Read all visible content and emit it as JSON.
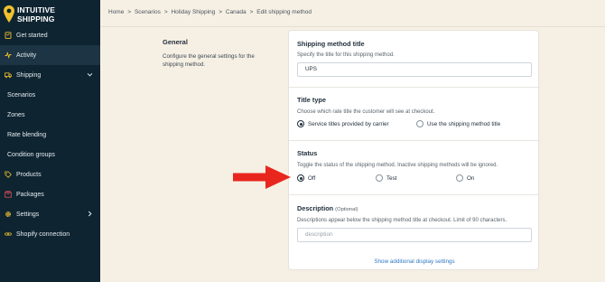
{
  "sidebar": {
    "logo_line1": "INTUITIVE",
    "logo_line2": "SHIPPING",
    "items": [
      {
        "label": "Get started",
        "icon": "checklist-icon"
      },
      {
        "label": "Activity",
        "icon": "activity-icon"
      },
      {
        "label": "Shipping",
        "icon": "truck-icon",
        "expanded": true
      },
      {
        "label": "Scenarios"
      },
      {
        "label": "Zones"
      },
      {
        "label": "Rate blending"
      },
      {
        "label": "Condition groups"
      },
      {
        "label": "Products",
        "icon": "tag-icon"
      },
      {
        "label": "Packages",
        "icon": "box-icon"
      },
      {
        "label": "Settings",
        "icon": "gear-icon"
      },
      {
        "label": "Shopify connection",
        "icon": "link-icon"
      }
    ]
  },
  "breadcrumb": [
    "Home",
    "Scenarios",
    "Holiday Shipping",
    "Canada",
    "Edit shipping method"
  ],
  "breadcrumb_sep": ">",
  "general": {
    "title": "General",
    "description": "Configure the general settings for the shipping method."
  },
  "method_title": {
    "title": "Shipping method title",
    "help": "Specify the title for this shipping method.",
    "value": "UPS"
  },
  "title_type": {
    "title": "Title type",
    "help": "Choose which rate title the customer will see at checkout.",
    "options": [
      "Service titles provided by carrier",
      "Use the shipping method title"
    ],
    "selected": 0
  },
  "status": {
    "title": "Status",
    "help": "Toggle the status of the shipping method. Inactive shipping methods will be ignored.",
    "options": [
      "Off",
      "Test",
      "On"
    ],
    "selected": 0
  },
  "description": {
    "title": "Description",
    "optional": "(Optional)",
    "help": "Descriptions appear below the shipping method title at checkout. Limit of 90 characters.",
    "placeholder": "description"
  },
  "additional_link": "Show additional display settings",
  "colors": {
    "sidebar": "#0e2431",
    "page_bg": "#f6f0e4",
    "logo_pin": "#f2c22c",
    "arrow": "#e8261e",
    "link": "#2f78c4"
  }
}
